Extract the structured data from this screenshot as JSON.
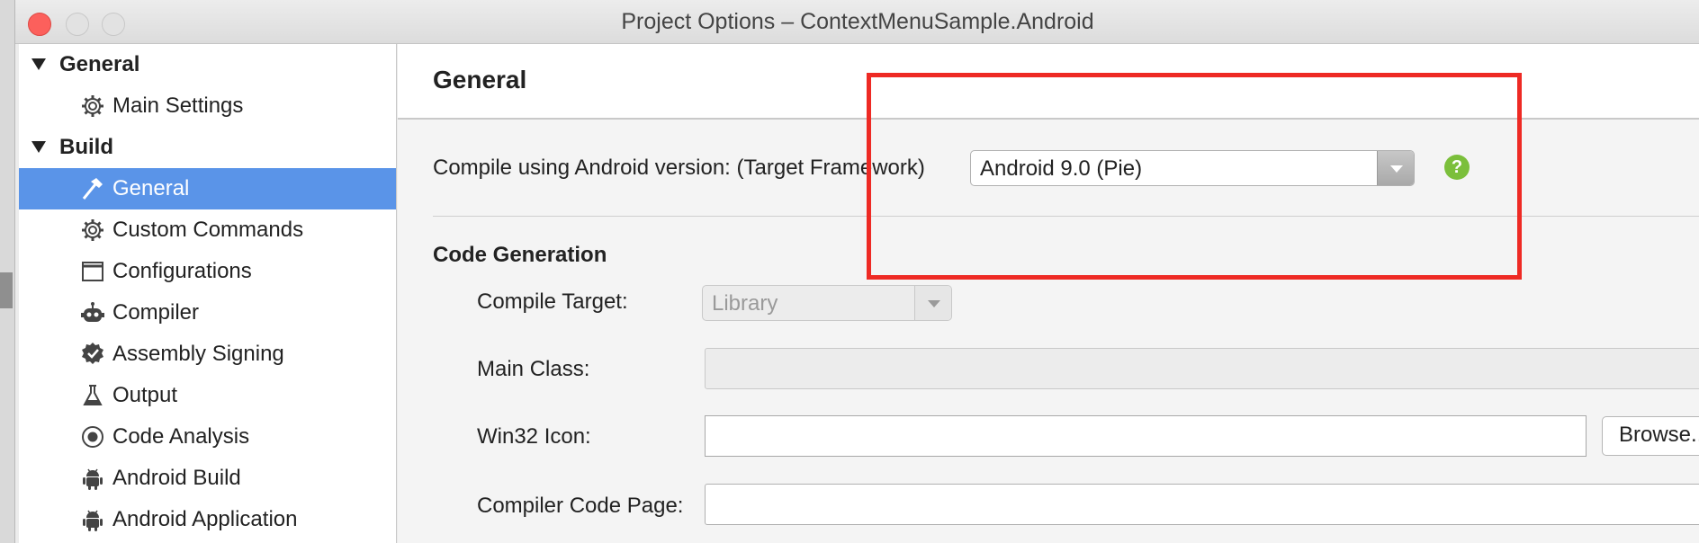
{
  "window": {
    "title": "Project Options – ContextMenuSample.Android"
  },
  "sidebar": {
    "groups": [
      {
        "label": "General",
        "items": [
          {
            "label": "Main Settings",
            "icon": "gear-icon"
          }
        ]
      },
      {
        "label": "Build",
        "items": [
          {
            "label": "General",
            "icon": "hammer-icon",
            "selected": true
          },
          {
            "label": "Custom Commands",
            "icon": "gear-icon"
          },
          {
            "label": "Configurations",
            "icon": "window-icon"
          },
          {
            "label": "Compiler",
            "icon": "robot-icon"
          },
          {
            "label": "Assembly Signing",
            "icon": "badge-icon"
          },
          {
            "label": "Output",
            "icon": "flask-icon"
          },
          {
            "label": "Code Analysis",
            "icon": "target-icon"
          },
          {
            "label": "Android Build",
            "icon": "android-icon"
          },
          {
            "label": "Android Application",
            "icon": "android-icon"
          }
        ]
      }
    ]
  },
  "main": {
    "title": "General",
    "target_framework_label": "Compile using Android version: (Target Framework)",
    "target_framework_value": "Android 9.0 (Pie)",
    "help_glyph": "?",
    "code_generation": {
      "heading": "Code Generation",
      "compile_target_label": "Compile Target:",
      "compile_target_value": "Library",
      "main_class_label": "Main Class:",
      "main_class_value": "",
      "win32_icon_label": "Win32 Icon:",
      "win32_icon_value": "",
      "browse_label": "Browse...",
      "code_page_label": "Compiler Code Page:",
      "code_page_value": ""
    }
  },
  "colors": {
    "selection": "#5a94e8",
    "close_button": "#fc605c",
    "help": "#7bbf3b",
    "annotation": "#ee2a24"
  }
}
